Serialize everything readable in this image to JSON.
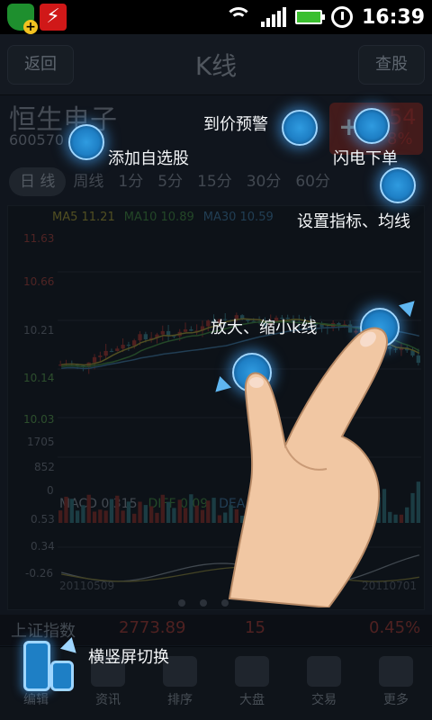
{
  "status_bar": {
    "time": "16:39",
    "icons": [
      "security-app-icon",
      "stock-app-icon",
      "wifi-icon",
      "signal-icon",
      "battery-icon",
      "alarm-icon"
    ]
  },
  "header": {
    "back_label": "返回",
    "title": "K线",
    "query_label": "查股"
  },
  "stock": {
    "name": "恒生电子",
    "code": "600570",
    "price": "54",
    "pct": "8%"
  },
  "tabs": [
    "日 线",
    "周线",
    "1分",
    "5分",
    "15分",
    "30分",
    "60分"
  ],
  "ma_legend": {
    "ma5": "MA5 11.21",
    "ma10": "MA10 10.89",
    "ma30": "MA30 10.59"
  },
  "price_axis": [
    "11.63",
    "10.66",
    "10.21",
    "10.14",
    "10.03"
  ],
  "volume_axis": [
    "1705",
    "852",
    "0"
  ],
  "macd": {
    "label": "MACD 0.315",
    "diff": "DIFF 0.09",
    "dea": "DEA",
    "axis": [
      "0.53",
      "0.34",
      "-0.26"
    ]
  },
  "dates": {
    "start": "20110509",
    "end": "20110701"
  },
  "index_bar": {
    "name": "上证指数",
    "value": "2773.89",
    "change": "15",
    "pct": "0.45%"
  },
  "bottom_nav": [
    {
      "label": "编辑",
      "icon": "edit-icon"
    },
    {
      "label": "资讯",
      "icon": "news-icon"
    },
    {
      "label": "排序",
      "icon": "sort-icon"
    },
    {
      "label": "大盘",
      "icon": "market-icon"
    },
    {
      "label": "交易",
      "icon": "trade-icon"
    },
    {
      "label": "更多",
      "icon": "more-icon"
    }
  ],
  "hints": {
    "add_watchlist": "添加自选股",
    "price_alert": "到价预警",
    "flash_order": "闪电下单",
    "set_indicators": "设置指标、均线",
    "zoom": "放大、缩小k线",
    "rotate": "横竖屏切换"
  },
  "colors": {
    "accent_blue": "#1e7fc5",
    "up_red": "#c83232",
    "down_green": "#2f8f3a"
  }
}
